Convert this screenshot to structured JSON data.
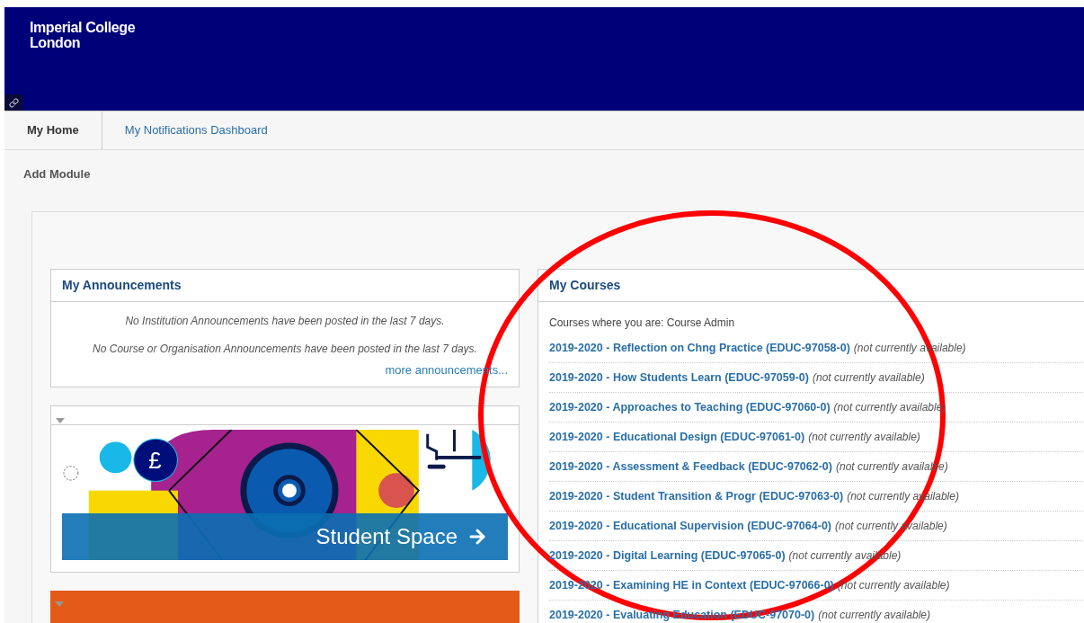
{
  "header": {
    "logo": [
      "Imperial College",
      "London"
    ]
  },
  "tabs": [
    {
      "label": "My Home",
      "selected": true
    },
    {
      "label": "My Notifications Dashboard",
      "selected": false
    }
  ],
  "add_module": "Add Module",
  "announcements": {
    "title": "My Announcements",
    "messages": [
      "No Institution Announcements have been posted in the last 7 days.",
      "No Course or Organisation Announcements have been posted in the last 7 days."
    ],
    "more_link": "more announcements..."
  },
  "student_space": {
    "symbol": "£",
    "banner_text": "Student Space"
  },
  "courses": {
    "title": "My Courses",
    "role_line": "Courses where you are: Course Admin",
    "items": [
      {
        "title": "2019-2020 - Reflection on Chng Practice (EDUC-97058-0)",
        "status": "(not currently available)"
      },
      {
        "title": "2019-2020 - How Students Learn (EDUC-97059-0)",
        "status": "(not currently available)"
      },
      {
        "title": "2019-2020 - Approaches to Teaching (EDUC-97060-0)",
        "status": "(not currently available)"
      },
      {
        "title": "2019-2020 - Educational Design (EDUC-97061-0)",
        "status": "(not currently available)"
      },
      {
        "title": "2019-2020 - Assessment & Feedback (EDUC-97062-0)",
        "status": "(not currently available)"
      },
      {
        "title": "2019-2020 - Student Transition & Progr (EDUC-97063-0)",
        "status": "(not currently available)"
      },
      {
        "title": "2019-2020 - Educational Supervision (EDUC-97064-0)",
        "status": "(not currently available)"
      },
      {
        "title": "2019-2020 - Digital Learning (EDUC-97065-0)",
        "status": "(not currently available)"
      },
      {
        "title": "2019-2020 - Examining HE in Context (EDUC-97066-0)",
        "status": "(not currently available)"
      },
      {
        "title": "2019-2020 - Evaluating Education (EDUC-97070-0)",
        "status": "(not currently available)"
      }
    ]
  }
}
